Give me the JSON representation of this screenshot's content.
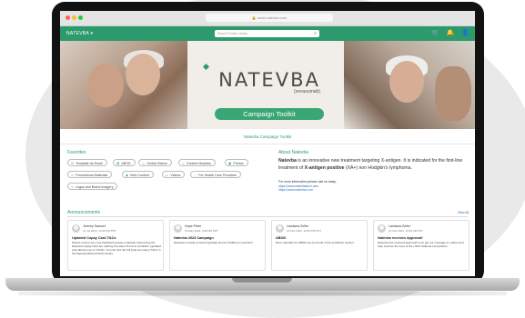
{
  "browser": {
    "url": "www.natevba.com"
  },
  "nav": {
    "app_name": "NATEVBA",
    "app_dropdown": "▾",
    "search_placeholder": "Search Portal Library",
    "search_icon": "search-icon",
    "icons": [
      "cart-icon",
      "bell-icon",
      "user-icon"
    ]
  },
  "hero": {
    "brand": "NATEVBA",
    "generic": "(vevasumab)",
    "button": "Campaign Toolkit"
  },
  "subtitle": "Natevba Campaign Toolkit",
  "favorites": {
    "title": "Favorites",
    "items": [
      "Template do Email",
      "ABOD",
      "Global Videos",
      "Content Modules",
      "Photos",
      "Promotional Materials",
      "Web Content",
      "Videos",
      "For Health Care Providers",
      "Logos and Brand Imagery"
    ]
  },
  "about": {
    "title": "About Natevba",
    "brand": "Natevba",
    "text_1": " is an innovative new treatment targeting X-antigen. It is indicated for the first-line treatment of ",
    "highlight": "X-antigen positive",
    "text_2": " (XA+) non Hodgkin's lymphoma.",
    "info_label": "For more information please visit us today:",
    "link_1": "https://www.natevbatech.com",
    "link_2": "https://www.natevba.com"
  },
  "announcements": {
    "title": "Announcements",
    "view_all": "View All",
    "cards": [
      {
        "name": "Jeremy Samuel",
        "date": "21 Jul 2024, 10:49 PM PDT",
        "headline": "Updated Copay Card T&Cs",
        "body": "Please ensure any new Fieldwork-Assets materials referencing the Natevba Copay Card are utilizing the latest Terms & Condition (updated and effective as of 7/1/24). You can find the full (and summary) T&Cs in the Natevba Brand Portal Library."
      },
      {
        "name": "Hope Peter",
        "date": "19 May 2024, 9:08 AM PDT",
        "headline": "Natevba 2024 Campaign",
        "body": "Natevba is ready to launch globally across 8 different countries!"
      },
      {
        "name": "Landana Zeller",
        "date": "13 Feb 2024, 10:52 PM PST",
        "headline": "ABOD",
        "body": "New materials for ABOD can be found in the quicklinks section."
      },
      {
        "name": "Landana Zeller",
        "date": "13 Feb 2024, 10:52 AM PST",
        "headline": "Natevba receives Approval!",
        "body": "Natevba has received Approval! Let's get our message to market and help improve the lives of XA+ NHL Patients everywhere!"
      }
    ]
  }
}
